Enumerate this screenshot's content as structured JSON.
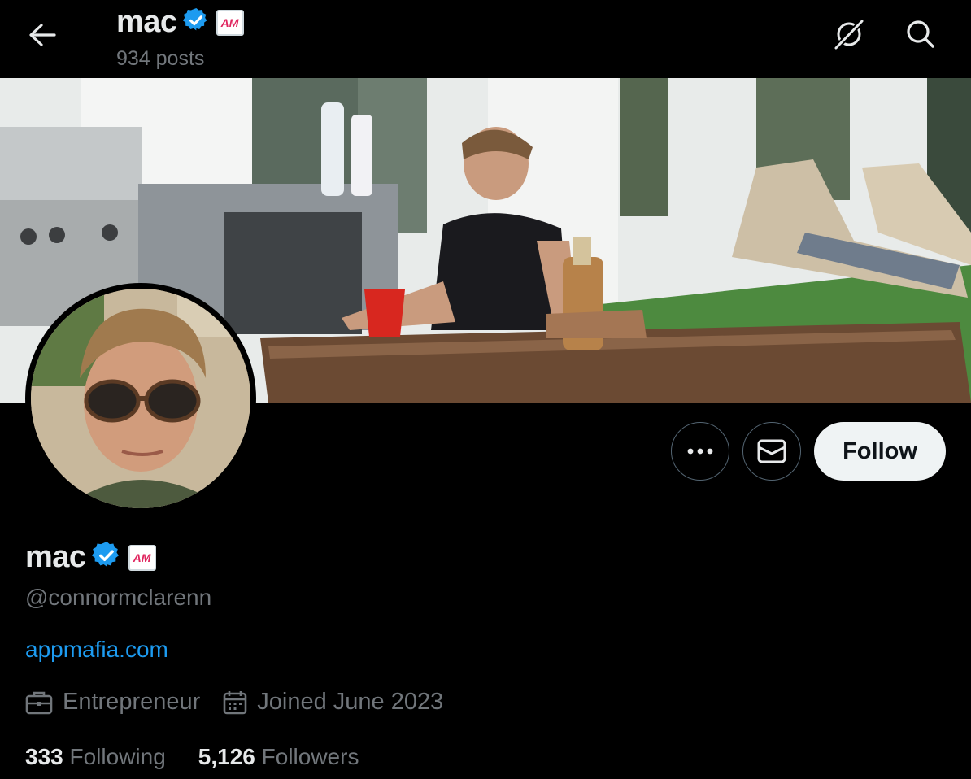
{
  "header": {
    "name": "mac",
    "posts": "934 posts",
    "affiliate_badge": "AM"
  },
  "profile": {
    "name": "mac",
    "handle": "@connormclarenn",
    "website": "appmafia.com",
    "profession": "Entrepreneur",
    "joined": "Joined June 2023",
    "affiliate_badge": "AM",
    "following_count": "333",
    "following_label": "Following",
    "followers_count": "5,126",
    "followers_label": "Followers"
  },
  "actions": {
    "follow_label": "Follow"
  },
  "colors": {
    "background": "#000000",
    "text_primary": "#e7e9ea",
    "text_secondary": "#71767b",
    "link": "#1d9bf0",
    "verified": "#1d9bf0",
    "follow_button_bg": "#eff3f4"
  },
  "icons": {
    "back": "arrow-left-icon",
    "grok": "grok-icon",
    "search": "search-icon",
    "more": "more-icon",
    "message": "envelope-icon",
    "verified": "verified-badge-icon",
    "profession": "briefcase-icon",
    "joined": "calendar-icon"
  }
}
